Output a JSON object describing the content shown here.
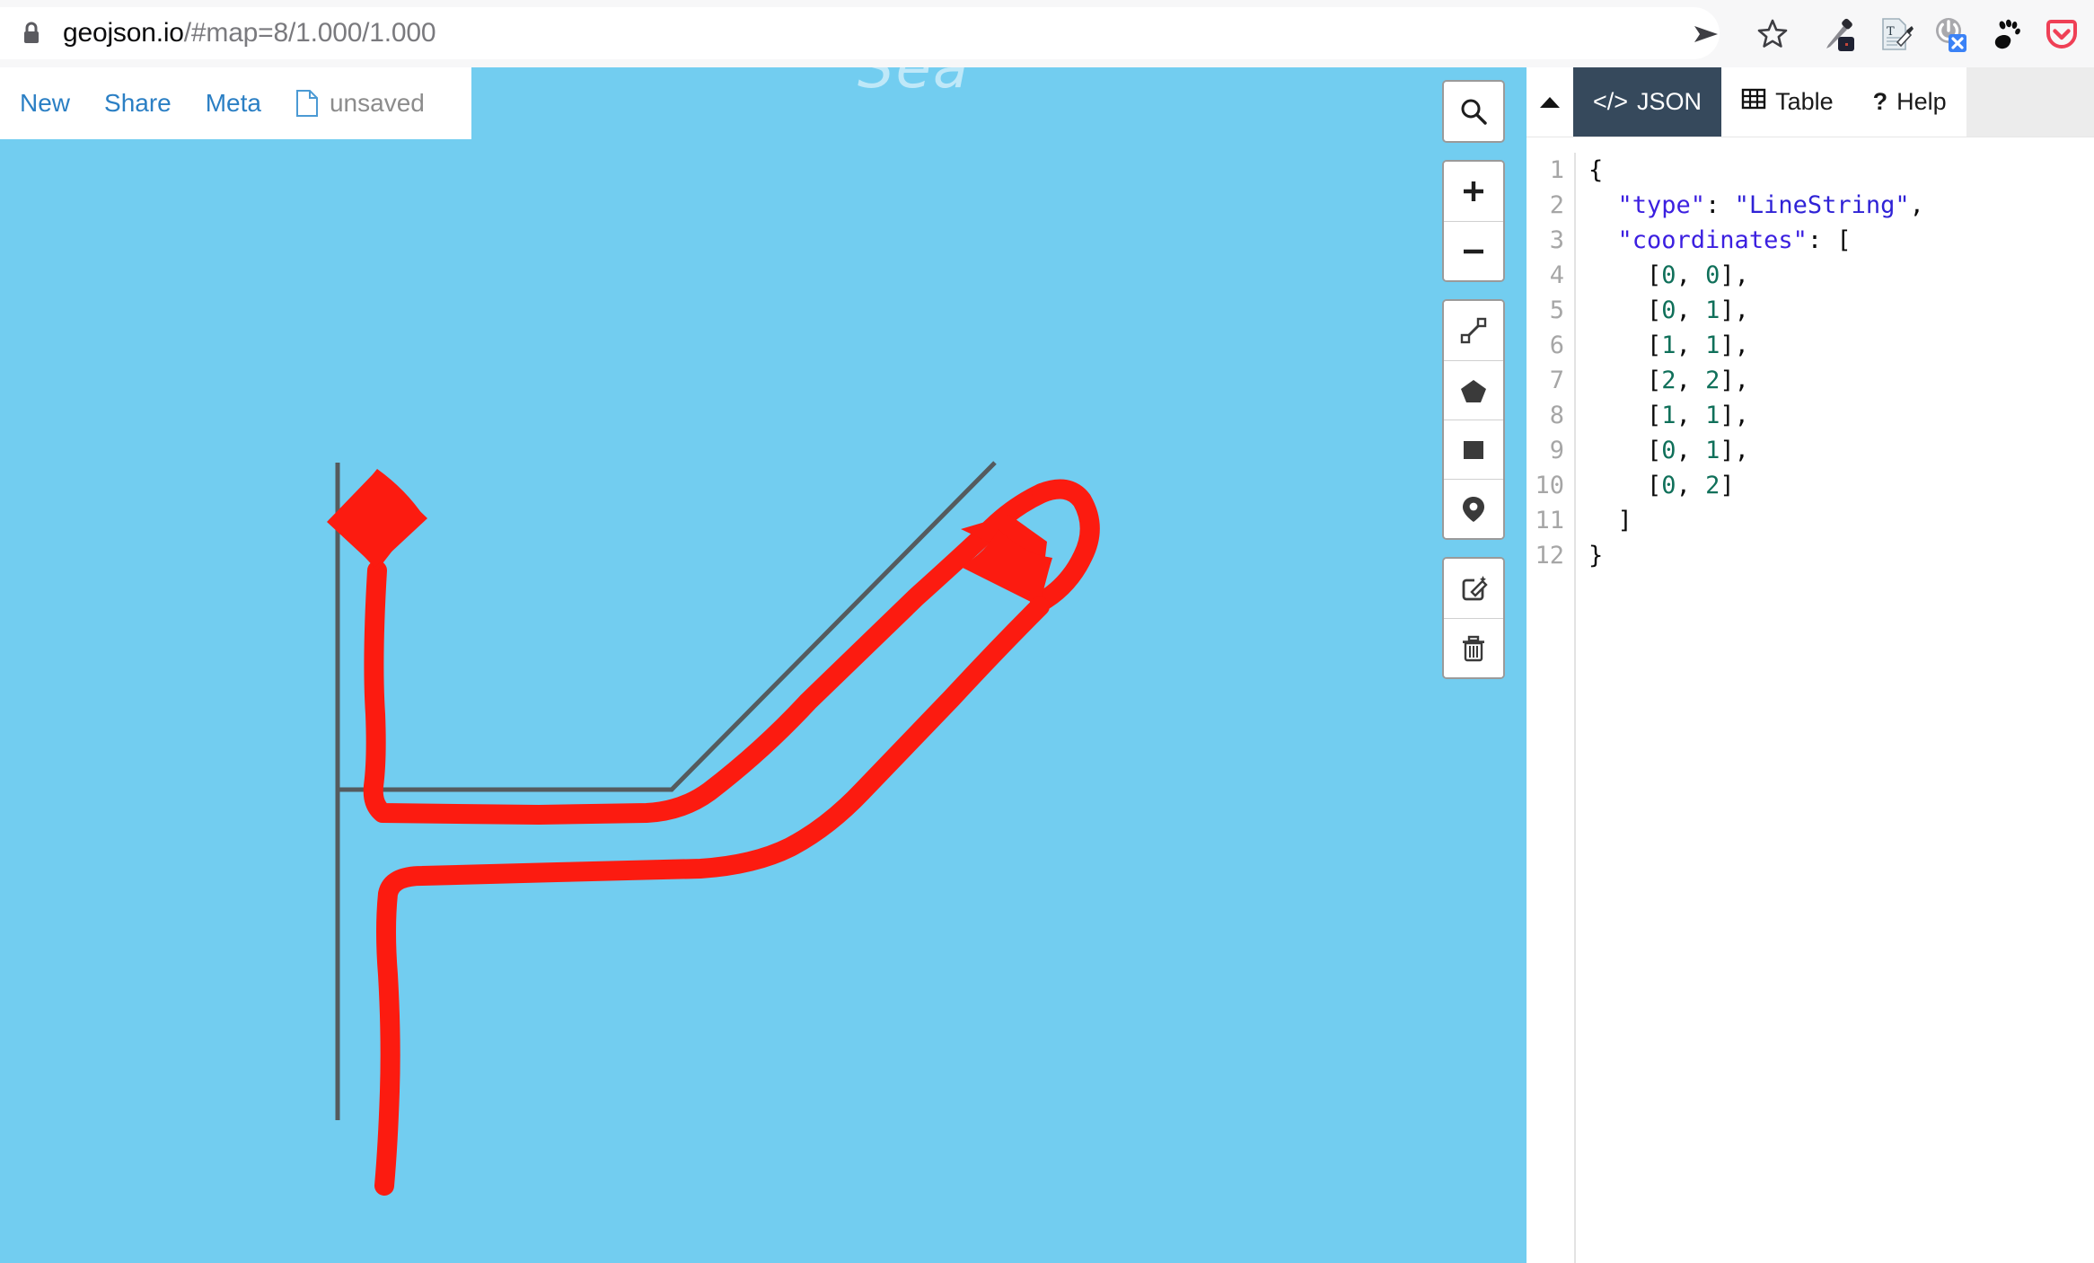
{
  "browser": {
    "url_host": "geojson.io",
    "url_path": "/#map=8/1.000/1.000",
    "lock_icon": "lock-icon",
    "icons": [
      {
        "name": "send-to-device-icon",
        "glyph": "➤"
      },
      {
        "name": "bookmark-star-icon",
        "glyph": "☆"
      },
      {
        "name": "color-picker-extension-icon",
        "glyph": "eyedropper"
      },
      {
        "name": "text-editor-extension-icon",
        "glyph": "document-pen"
      },
      {
        "name": "disable-extension-icon",
        "glyph": "power-x"
      },
      {
        "name": "gnome-extension-icon",
        "glyph": "gnome-foot"
      },
      {
        "name": "pocket-icon",
        "glyph": "pocket-shield"
      }
    ]
  },
  "toolbar": {
    "new_label": "New",
    "share_label": "Share",
    "meta_label": "Meta",
    "file_icon": "file-icon",
    "filename": "unsaved"
  },
  "map": {
    "background_color": "#72cdf0",
    "cut_label": "Sea",
    "geometry_color": "#555b5e",
    "annotation_color": "#fc1b10",
    "controls": [
      {
        "name": "search-icon",
        "label": "Search"
      },
      {
        "name": "zoom-in-icon",
        "label": "+"
      },
      {
        "name": "zoom-out-icon",
        "label": "−"
      },
      {
        "name": "draw-line-icon",
        "label": "Draw LineString"
      },
      {
        "name": "draw-polygon-icon",
        "label": "Draw Polygon"
      },
      {
        "name": "draw-rectangle-icon",
        "label": "Draw Rectangle"
      },
      {
        "name": "draw-marker-icon",
        "label": "Draw Marker"
      },
      {
        "name": "edit-layers-icon",
        "label": "Edit layers"
      },
      {
        "name": "delete-layers-icon",
        "label": "Delete layers"
      }
    ]
  },
  "editor": {
    "collapse_icon": "chevron-up-icon",
    "tabs": [
      {
        "name": "tab-json",
        "icon": "code-icon",
        "icon_glyph": "</>",
        "label": "JSON",
        "active": true
      },
      {
        "name": "tab-table",
        "icon": "table-icon",
        "icon_glyph": "☷",
        "label": "Table",
        "active": false
      },
      {
        "name": "tab-help",
        "icon": "help-icon",
        "icon_glyph": "?",
        "label": "Help",
        "active": false
      }
    ],
    "line_numbers": [
      "1",
      "2",
      "3",
      "4",
      "5",
      "6",
      "7",
      "8",
      "9",
      "10",
      "11",
      "12"
    ],
    "code_lines": [
      [
        {
          "t": "pun",
          "v": "{"
        }
      ],
      [
        {
          "t": "sp",
          "v": "  "
        },
        {
          "t": "key",
          "v": "\"type\""
        },
        {
          "t": "pun",
          "v": ": "
        },
        {
          "t": "str",
          "v": "\"LineString\""
        },
        {
          "t": "pun",
          "v": ","
        }
      ],
      [
        {
          "t": "sp",
          "v": "  "
        },
        {
          "t": "key",
          "v": "\"coordinates\""
        },
        {
          "t": "pun",
          "v": ": ["
        }
      ],
      [
        {
          "t": "sp",
          "v": "    "
        },
        {
          "t": "pun",
          "v": "["
        },
        {
          "t": "num",
          "v": "0"
        },
        {
          "t": "pun",
          "v": ", "
        },
        {
          "t": "num",
          "v": "0"
        },
        {
          "t": "pun",
          "v": "],"
        }
      ],
      [
        {
          "t": "sp",
          "v": "    "
        },
        {
          "t": "pun",
          "v": "["
        },
        {
          "t": "num",
          "v": "0"
        },
        {
          "t": "pun",
          "v": ", "
        },
        {
          "t": "num",
          "v": "1"
        },
        {
          "t": "pun",
          "v": "],"
        }
      ],
      [
        {
          "t": "sp",
          "v": "    "
        },
        {
          "t": "pun",
          "v": "["
        },
        {
          "t": "num",
          "v": "1"
        },
        {
          "t": "pun",
          "v": ", "
        },
        {
          "t": "num",
          "v": "1"
        },
        {
          "t": "pun",
          "v": "],"
        }
      ],
      [
        {
          "t": "sp",
          "v": "    "
        },
        {
          "t": "pun",
          "v": "["
        },
        {
          "t": "num",
          "v": "2"
        },
        {
          "t": "pun",
          "v": ", "
        },
        {
          "t": "num",
          "v": "2"
        },
        {
          "t": "pun",
          "v": "],"
        }
      ],
      [
        {
          "t": "sp",
          "v": "    "
        },
        {
          "t": "pun",
          "v": "["
        },
        {
          "t": "num",
          "v": "1"
        },
        {
          "t": "pun",
          "v": ", "
        },
        {
          "t": "num",
          "v": "1"
        },
        {
          "t": "pun",
          "v": "],"
        }
      ],
      [
        {
          "t": "sp",
          "v": "    "
        },
        {
          "t": "pun",
          "v": "["
        },
        {
          "t": "num",
          "v": "0"
        },
        {
          "t": "pun",
          "v": ", "
        },
        {
          "t": "num",
          "v": "1"
        },
        {
          "t": "pun",
          "v": "],"
        }
      ],
      [
        {
          "t": "sp",
          "v": "    "
        },
        {
          "t": "pun",
          "v": "["
        },
        {
          "t": "num",
          "v": "0"
        },
        {
          "t": "pun",
          "v": ", "
        },
        {
          "t": "num",
          "v": "2"
        },
        {
          "t": "pun",
          "v": "]"
        }
      ],
      [
        {
          "t": "sp",
          "v": "  "
        },
        {
          "t": "pun",
          "v": "]"
        }
      ],
      [
        {
          "t": "pun",
          "v": "}"
        }
      ]
    ]
  },
  "geojson": {
    "type": "LineString",
    "coordinates": [
      [
        0,
        0
      ],
      [
        0,
        1
      ],
      [
        1,
        1
      ],
      [
        2,
        2
      ],
      [
        1,
        1
      ],
      [
        0,
        1
      ],
      [
        0,
        2
      ]
    ]
  }
}
